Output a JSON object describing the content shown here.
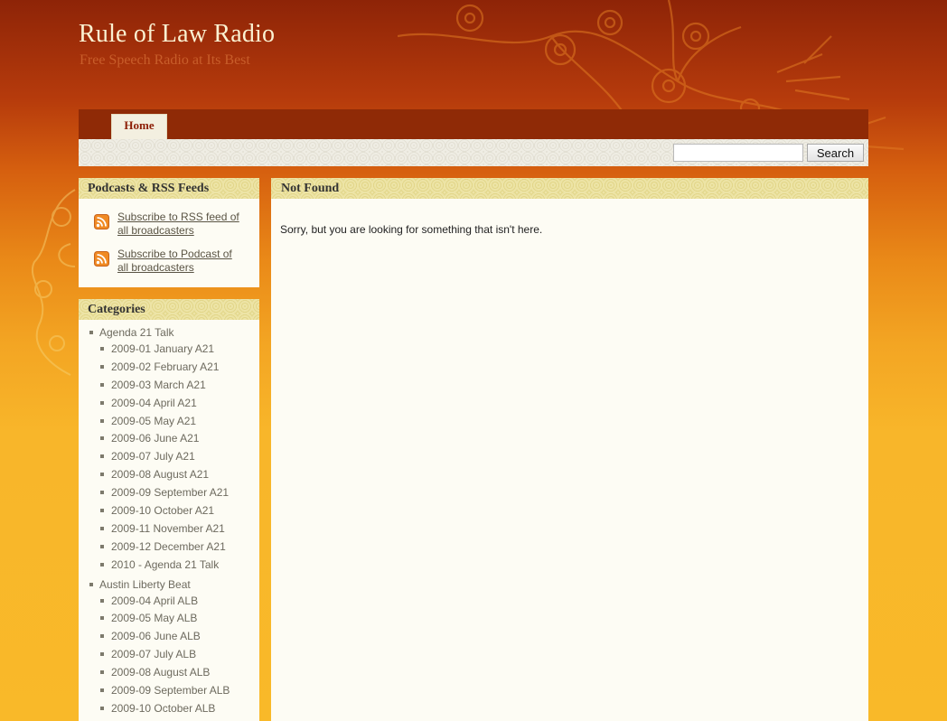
{
  "site": {
    "title": "Rule of Law Radio",
    "tagline": "Free Speech Radio at Its Best"
  },
  "nav": {
    "tabs": [
      {
        "label": "Home"
      }
    ]
  },
  "search": {
    "value": "",
    "button_label": "Search"
  },
  "sidebar": {
    "podcasts": {
      "title": "Podcasts & RSS Feeds",
      "items": [
        {
          "label": "Subscribe to RSS feed of all broadcasters",
          "icon": "rss-icon"
        },
        {
          "label": "Subscribe to Podcast of all broadcasters",
          "icon": "rss-icon"
        }
      ]
    },
    "categories": {
      "title": "Categories",
      "groups": [
        {
          "label": "Agenda 21 Talk",
          "children": [
            "2009-01 January A21",
            "2009-02 February A21",
            "2009-03 March A21",
            "2009-04 April A21",
            "2009-05 May A21",
            "2009-06 June A21",
            "2009-07 July A21",
            "2009-08 August A21",
            "2009-09 September A21",
            "2009-10 October A21",
            "2009-11 November A21",
            "2009-12 December A21",
            "2010 - Agenda 21 Talk"
          ]
        },
        {
          "label": "Austin Liberty Beat",
          "children": [
            "2009-04 April ALB",
            "2009-05 May ALB",
            "2009-06 June ALB",
            "2009-07 July ALB",
            "2009-08 August ALB",
            "2009-09 September ALB",
            "2009-10 October ALB"
          ]
        }
      ]
    }
  },
  "main": {
    "title": "Not Found",
    "message": "Sorry, but you are looking for something that isn't here."
  },
  "colors": {
    "header_dark": "#8e2407",
    "background_gold": "#f9b929",
    "nav_bar": "#8f2a06",
    "nav_tab_text": "#8c1d05",
    "title_text": "#fbf2d2",
    "tagline_text": "#c85d2a",
    "panel_bg": "#fdfcf4",
    "panel_header": "#ede4a6"
  }
}
